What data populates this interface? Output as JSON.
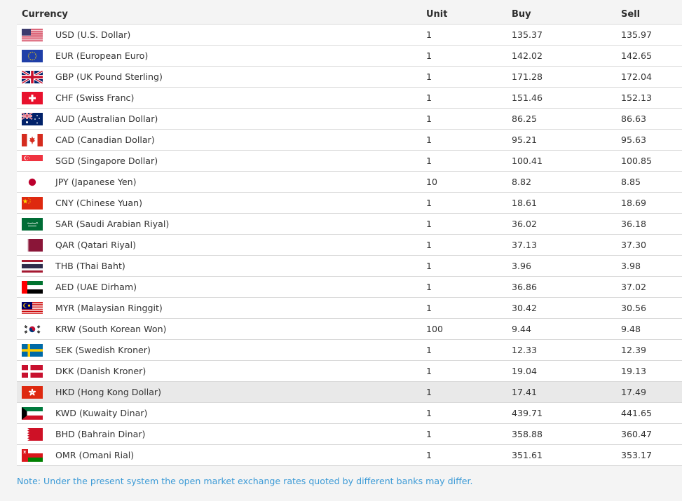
{
  "table": {
    "headers": {
      "currency": "Currency",
      "unit": "Unit",
      "buy": "Buy",
      "sell": "Sell"
    },
    "rows": [
      {
        "code": "USD",
        "name": "USD (U.S. Dollar)",
        "unit": "1",
        "buy": "135.37",
        "sell": "135.97",
        "flag_icon": "usa-flag-icon"
      },
      {
        "code": "EUR",
        "name": "EUR (European Euro)",
        "unit": "1",
        "buy": "142.02",
        "sell": "142.65",
        "flag_icon": "eu-flag-icon"
      },
      {
        "code": "GBP",
        "name": "GBP (UK Pound Sterling)",
        "unit": "1",
        "buy": "171.28",
        "sell": "172.04",
        "flag_icon": "uk-flag-icon"
      },
      {
        "code": "CHF",
        "name": "CHF (Swiss Franc)",
        "unit": "1",
        "buy": "151.46",
        "sell": "152.13",
        "flag_icon": "switzerland-flag-icon"
      },
      {
        "code": "AUD",
        "name": "AUD (Australian Dollar)",
        "unit": "1",
        "buy": "86.25",
        "sell": "86.63",
        "flag_icon": "australia-flag-icon"
      },
      {
        "code": "CAD",
        "name": "CAD (Canadian Dollar)",
        "unit": "1",
        "buy": "95.21",
        "sell": "95.63",
        "flag_icon": "canada-flag-icon"
      },
      {
        "code": "SGD",
        "name": "SGD (Singapore Dollar)",
        "unit": "1",
        "buy": "100.41",
        "sell": "100.85",
        "flag_icon": "singapore-flag-icon"
      },
      {
        "code": "JPY",
        "name": "JPY (Japanese Yen)",
        "unit": "10",
        "buy": "8.82",
        "sell": "8.85",
        "flag_icon": "japan-flag-icon"
      },
      {
        "code": "CNY",
        "name": "CNY (Chinese Yuan)",
        "unit": "1",
        "buy": "18.61",
        "sell": "18.69",
        "flag_icon": "china-flag-icon"
      },
      {
        "code": "SAR",
        "name": "SAR (Saudi Arabian Riyal)",
        "unit": "1",
        "buy": "36.02",
        "sell": "36.18",
        "flag_icon": "saudi-arabia-flag-icon"
      },
      {
        "code": "QAR",
        "name": "QAR (Qatari Riyal)",
        "unit": "1",
        "buy": "37.13",
        "sell": "37.30",
        "flag_icon": "qatar-flag-icon"
      },
      {
        "code": "THB",
        "name": "THB (Thai Baht)",
        "unit": "1",
        "buy": "3.96",
        "sell": "3.98",
        "flag_icon": "thailand-flag-icon"
      },
      {
        "code": "AED",
        "name": "AED (UAE Dirham)",
        "unit": "1",
        "buy": "36.86",
        "sell": "37.02",
        "flag_icon": "uae-flag-icon"
      },
      {
        "code": "MYR",
        "name": "MYR (Malaysian Ringgit)",
        "unit": "1",
        "buy": "30.42",
        "sell": "30.56",
        "flag_icon": "malaysia-flag-icon"
      },
      {
        "code": "KRW",
        "name": "KRW (South Korean Won)",
        "unit": "100",
        "buy": "9.44",
        "sell": "9.48",
        "flag_icon": "south-korea-flag-icon"
      },
      {
        "code": "SEK",
        "name": "SEK (Swedish Kroner)",
        "unit": "1",
        "buy": "12.33",
        "sell": "12.39",
        "flag_icon": "sweden-flag-icon"
      },
      {
        "code": "DKK",
        "name": "DKK (Danish Kroner)",
        "unit": "1",
        "buy": "19.04",
        "sell": "19.13",
        "flag_icon": "denmark-flag-icon"
      },
      {
        "code": "HKD",
        "name": "HKD (Hong Kong Dollar)",
        "unit": "1",
        "buy": "17.41",
        "sell": "17.49",
        "flag_icon": "hong-kong-flag-icon",
        "highlighted": true
      },
      {
        "code": "KWD",
        "name": "KWD (Kuwaity Dinar)",
        "unit": "1",
        "buy": "439.71",
        "sell": "441.65",
        "flag_icon": "kuwait-flag-icon"
      },
      {
        "code": "BHD",
        "name": "BHD (Bahrain Dinar)",
        "unit": "1",
        "buy": "358.88",
        "sell": "360.47",
        "flag_icon": "bahrain-flag-icon"
      },
      {
        "code": "OMR",
        "name": "OMR (Omani Rial)",
        "unit": "1",
        "buy": "351.61",
        "sell": "353.17",
        "flag_icon": "oman-flag-icon"
      }
    ]
  },
  "note": "Note: Under the present system the open market exchange rates quoted by different banks may differ.",
  "colors": {
    "note_text": "#3b9ad6",
    "row_highlight": "#e9e9e9",
    "background": "#f4f4f4"
  }
}
